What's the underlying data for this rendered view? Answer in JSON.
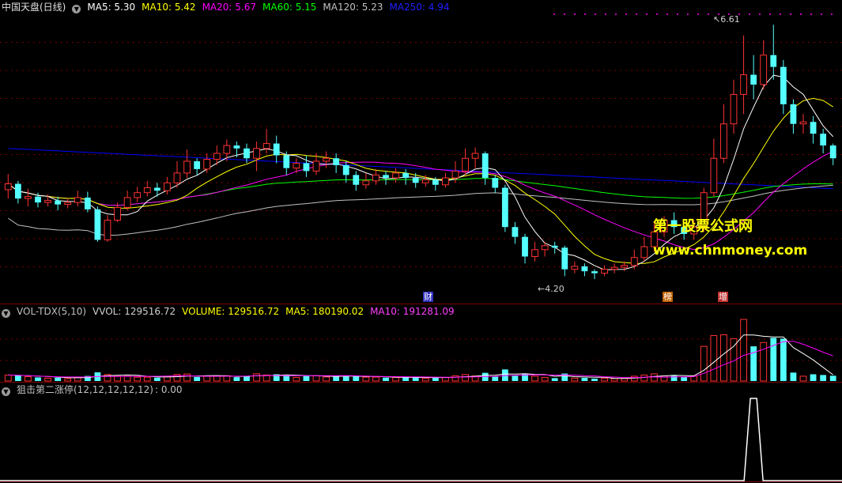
{
  "colors": {
    "up": "#ff3232",
    "down": "#54ffff",
    "ma5": "#ffffff",
    "ma10": "#ffff00",
    "ma20": "#ff00ff",
    "ma60": "#00ff00",
    "ma120": "#c0c0c0",
    "ma250": "#0000ff",
    "grid": "#7a0000",
    "signal": "#ffffff"
  },
  "main_header": {
    "stock_name": "中国天盘(日线)",
    "items": [
      {
        "label": "MA5: 5.30",
        "color": "#ffffff"
      },
      {
        "label": "MA10: 5.42",
        "color": "#ffff00"
      },
      {
        "label": "MA20: 5.67",
        "color": "#ff00ff"
      },
      {
        "label": "MA60: 5.15",
        "color": "#00ff00"
      },
      {
        "label": "MA120: 5.23",
        "color": "#c0c0c0"
      },
      {
        "label": "MA250: 4.94",
        "color": "#2020ff"
      }
    ]
  },
  "volume_header": {
    "name": "VOL-TDX(5,10)",
    "items": [
      {
        "label": "VVOL: 129516.72",
        "color": "#d0d0d0"
      },
      {
        "label": "VOLUME: 129516.72",
        "color": "#ffff00"
      },
      {
        "label": "MA5: 180190.02",
        "color": "#ffff00"
      },
      {
        "label": "MA10: 191281.09",
        "color": "#ff40ff"
      }
    ]
  },
  "signal_header": {
    "name": "狙击第二涨停(12,12,12,12,12)",
    "value": ": 0.00"
  },
  "annotations": {
    "high": "6.61",
    "low": "4.20"
  },
  "markers": [
    {
      "label": "财",
      "color": "#3030c0"
    },
    {
      "label": "榜",
      "color": "#c06000"
    },
    {
      "label": "增",
      "color": "#c03030"
    }
  ],
  "watermark": {
    "line1": "第一股票公式网",
    "line2": "www.chnmoney.com"
  },
  "chart_data": {
    "type": "candlestick",
    "bars_count": 84,
    "price_range": [
      3.9,
      6.7
    ],
    "candles": [
      [
        4.93,
        4.99,
        4.84,
        5.09
      ],
      [
        4.99,
        4.84,
        4.79,
        5.02
      ],
      [
        4.84,
        4.86,
        4.76,
        4.94
      ],
      [
        4.86,
        4.8,
        4.75,
        4.9
      ],
      [
        4.8,
        4.82,
        4.76,
        4.88
      ],
      [
        4.82,
        4.78,
        4.72,
        4.86
      ],
      [
        4.78,
        4.8,
        4.74,
        4.84
      ],
      [
        4.8,
        4.85,
        4.76,
        4.92
      ],
      [
        4.85,
        4.73,
        4.7,
        4.91
      ],
      [
        4.73,
        4.42,
        4.4,
        4.76
      ],
      [
        4.42,
        4.62,
        4.4,
        4.67
      ],
      [
        4.62,
        4.75,
        4.6,
        4.8
      ],
      [
        4.75,
        4.85,
        4.72,
        4.92
      ],
      [
        4.85,
        4.9,
        4.8,
        4.96
      ],
      [
        4.9,
        4.95,
        4.86,
        5.02
      ],
      [
        4.95,
        4.92,
        4.86,
        5.0
      ],
      [
        4.92,
        5.0,
        4.88,
        5.06
      ],
      [
        5.0,
        5.1,
        4.95,
        5.22
      ],
      [
        5.1,
        5.22,
        5.05,
        5.34
      ],
      [
        5.22,
        5.14,
        5.08,
        5.25
      ],
      [
        5.14,
        5.24,
        5.1,
        5.3
      ],
      [
        5.24,
        5.3,
        5.18,
        5.38
      ],
      [
        5.3,
        5.38,
        5.22,
        5.44
      ],
      [
        5.38,
        5.35,
        5.26,
        5.42
      ],
      [
        5.35,
        5.25,
        5.2,
        5.4
      ],
      [
        5.25,
        5.35,
        5.12,
        5.42
      ],
      [
        5.35,
        5.4,
        5.3,
        5.55
      ],
      [
        5.4,
        5.28,
        5.2,
        5.48
      ],
      [
        5.28,
        5.15,
        5.08,
        5.32
      ],
      [
        5.15,
        5.2,
        5.1,
        5.25
      ],
      [
        5.2,
        5.12,
        5.06,
        5.28
      ],
      [
        5.12,
        5.22,
        5.08,
        5.3
      ],
      [
        5.22,
        5.25,
        5.15,
        5.32
      ],
      [
        5.25,
        5.18,
        5.1,
        5.3
      ],
      [
        5.18,
        5.08,
        5.0,
        5.22
      ],
      [
        5.08,
        4.98,
        4.92,
        5.12
      ],
      [
        4.98,
        5.02,
        4.94,
        5.1
      ],
      [
        5.02,
        5.08,
        4.98,
        5.14
      ],
      [
        5.08,
        5.05,
        4.98,
        5.12
      ],
      [
        5.05,
        5.1,
        5.0,
        5.15
      ],
      [
        5.1,
        5.05,
        4.98,
        5.14
      ],
      [
        5.05,
        5.0,
        4.95,
        5.1
      ],
      [
        5.0,
        5.03,
        4.96,
        5.08
      ],
      [
        5.03,
        4.98,
        4.92,
        5.06
      ],
      [
        4.98,
        5.05,
        4.95,
        5.1
      ],
      [
        5.05,
        5.12,
        5.0,
        5.22
      ],
      [
        5.12,
        5.25,
        5.08,
        5.35
      ],
      [
        5.25,
        5.3,
        5.15,
        5.36
      ],
      [
        5.3,
        5.05,
        4.98,
        5.32
      ],
      [
        5.05,
        4.95,
        4.9,
        5.08
      ],
      [
        4.95,
        4.55,
        4.5,
        4.98
      ],
      [
        4.55,
        4.45,
        4.38,
        4.6
      ],
      [
        4.45,
        4.25,
        4.18,
        4.48
      ],
      [
        4.25,
        4.32,
        4.2,
        4.4
      ],
      [
        4.32,
        4.36,
        4.25,
        4.4
      ],
      [
        4.36,
        4.34,
        4.28,
        4.4
      ],
      [
        4.34,
        4.12,
        4.05,
        4.36
      ],
      [
        4.12,
        4.15,
        4.08,
        4.2
      ],
      [
        4.15,
        4.1,
        4.05,
        4.18
      ],
      [
        4.1,
        4.08,
        4.02,
        4.12
      ],
      [
        4.08,
        4.12,
        4.05,
        4.16
      ],
      [
        4.12,
        4.14,
        4.08,
        4.18
      ],
      [
        4.14,
        4.16,
        4.1,
        4.2
      ],
      [
        4.16,
        4.24,
        4.12,
        4.32
      ],
      [
        4.24,
        4.35,
        4.2,
        4.45
      ],
      [
        4.35,
        4.5,
        4.3,
        4.6
      ],
      [
        4.5,
        4.62,
        4.45,
        4.66
      ],
      [
        4.62,
        4.55,
        4.48,
        4.7
      ],
      [
        4.55,
        4.48,
        4.42,
        4.58
      ],
      [
        4.48,
        4.55,
        4.42,
        4.62
      ],
      [
        4.55,
        4.9,
        4.5,
        4.95
      ],
      [
        4.9,
        5.25,
        4.86,
        5.45
      ],
      [
        5.25,
        5.6,
        5.2,
        5.8
      ],
      [
        5.6,
        5.9,
        5.5,
        6.05
      ],
      [
        5.9,
        6.1,
        5.7,
        6.5
      ],
      [
        6.1,
        6.0,
        5.85,
        6.3
      ],
      [
        6.0,
        6.3,
        5.95,
        6.45
      ],
      [
        6.3,
        6.18,
        6.05,
        6.61
      ],
      [
        6.18,
        5.8,
        5.7,
        6.25
      ],
      [
        5.8,
        5.6,
        5.5,
        5.85
      ],
      [
        5.6,
        5.62,
        5.5,
        5.7
      ],
      [
        5.62,
        5.5,
        5.4,
        5.68
      ],
      [
        5.5,
        5.38,
        5.3,
        5.55
      ],
      [
        5.38,
        5.25,
        5.18,
        5.4
      ]
    ],
    "volume_ma_series": [
      "MA5",
      "MA10"
    ],
    "volume_labels": {
      "vvol": 129516.72,
      "volume": 129516.72,
      "ma5": 180190.02,
      "ma10": 191281.09
    }
  }
}
